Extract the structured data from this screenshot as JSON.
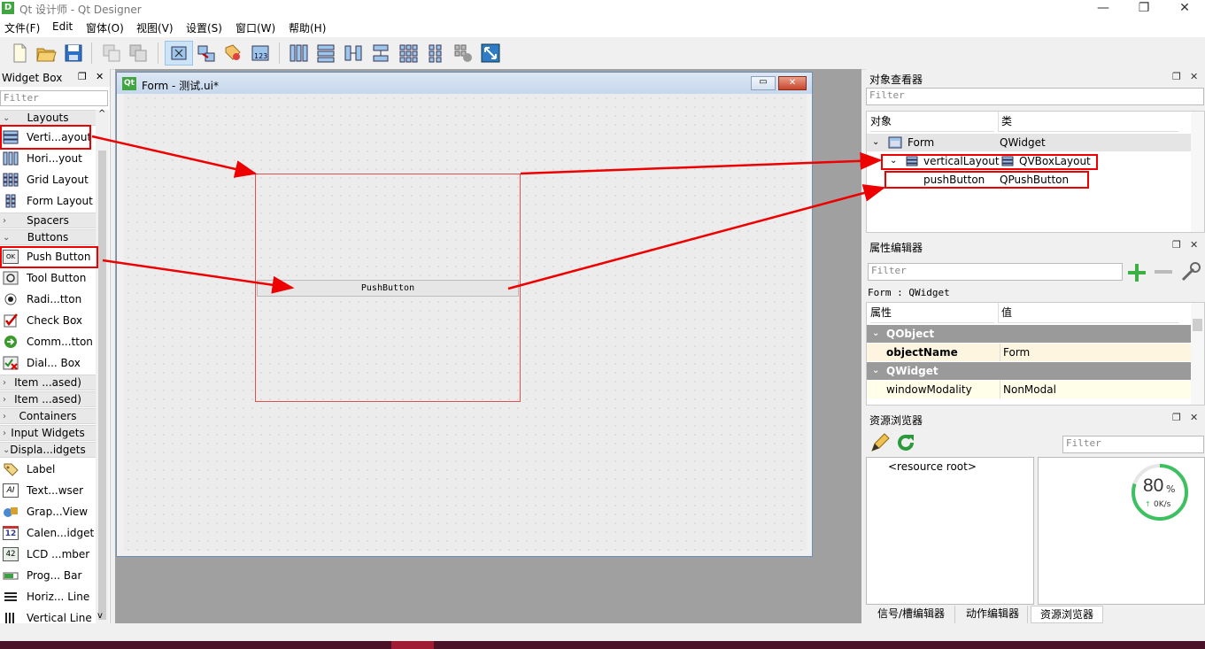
{
  "window": {
    "title": "Qt 设计师 - Qt Designer",
    "app_icon_text": "D",
    "minimize_glyph": "—",
    "maximize_glyph": "❐",
    "close_glyph": "✕"
  },
  "menu": [
    "文件(F)",
    "Edit",
    "窗体(O)",
    "视图(V)",
    "设置(S)",
    "窗口(W)",
    "帮助(H)"
  ],
  "widget_box": {
    "title": "Widget Box",
    "filter_placeholder": "Filter",
    "categories": {
      "layouts": "Layouts",
      "spacers": "Spacers",
      "buttons": "Buttons",
      "item_views": "Item ...ased)",
      "item_widgets": "Item ...ased)",
      "containers": "Containers",
      "input_widgets": "Input Widgets",
      "display_widgets": "Displa...idgets"
    },
    "layout_items": [
      "Verti...ayout",
      "Hori...yout",
      "Grid Layout",
      "Form Layout"
    ],
    "button_items": [
      "Push Button",
      "Tool Button",
      "Radi...tton",
      "Check Box",
      "Comm...tton",
      "Dial... Box"
    ],
    "display_items": [
      "Label",
      "Text...wser",
      "Grap...View",
      "Calen...idget",
      "LCD ...mber",
      "Prog... Bar",
      "Horiz... Line",
      "Vertical Line"
    ],
    "ok_icon_text": "OK",
    "ai_icon_text": "AI",
    "calendar_icon_text": "12",
    "lcd_icon_text": "42"
  },
  "form": {
    "title": "Form - 测试.ui*",
    "qt_icon_text": "Qt",
    "push_button_text": "PushButton"
  },
  "object_inspector": {
    "title": "对象查看器",
    "filter_placeholder": "Filter",
    "col_object": "对象",
    "col_class": "类",
    "rows": [
      {
        "object": "Form",
        "class": "QWidget"
      },
      {
        "object": "verticalLayout",
        "class": "QVBoxLayout"
      },
      {
        "object": "pushButton",
        "class": "QPushButton"
      }
    ]
  },
  "property_editor": {
    "title": "属性编辑器",
    "filter_placeholder": "Filter",
    "context": "Form : QWidget",
    "col_property": "属性",
    "col_value": "值",
    "groups": [
      "QObject",
      "QWidget"
    ],
    "rows": [
      {
        "property": "objectName",
        "value": "Form"
      },
      {
        "property": "windowModality",
        "value": "NonModal"
      }
    ]
  },
  "resource_browser": {
    "title": "资源浏览器",
    "filter_placeholder": "Filter",
    "root": "<resource root>",
    "network_percent": "80",
    "percent_sign": "%",
    "network_speed": "0K/s",
    "up_arrow": "↑"
  },
  "bottom_tabs": [
    "信号/槽编辑器",
    "动作编辑器",
    "资源浏览器"
  ],
  "colors": {
    "highlight_red": "#e00000",
    "gauge_green": "#3cc060",
    "group_gray": "#9a9a9a",
    "prop_row_bg": "#fdf5df",
    "prop_row_bg2": "#fffee8"
  }
}
